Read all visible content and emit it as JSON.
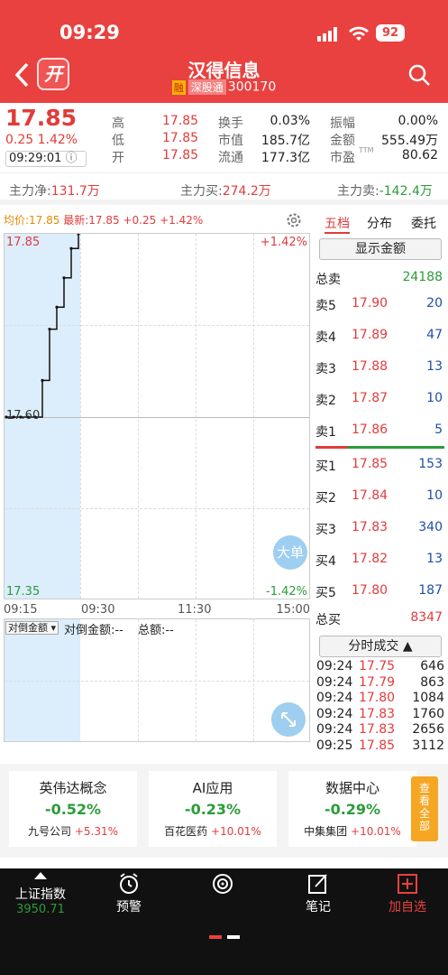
{
  "status": {
    "time": "09:29",
    "battery": "92"
  },
  "nav": {
    "logo": "开",
    "name": "汉得信息",
    "tag1": "融",
    "tag2": "深股通",
    "code": "300170"
  },
  "quote": {
    "price": "17.85",
    "change": "0.25",
    "change_pct": "1.42%",
    "time": "09:29:01",
    "cells": [
      {
        "label": "高",
        "value": "17.85",
        "color": "red"
      },
      {
        "label": "换手",
        "value": "0.03%",
        "color": "dark"
      },
      {
        "label": "振幅",
        "value": "0.00%",
        "color": "dark"
      },
      {
        "label": "低",
        "value": "17.85",
        "color": "red"
      },
      {
        "label": "市值",
        "value": "185.7亿",
        "color": "dark"
      },
      {
        "label": "金额",
        "value": "555.49万",
        "color": "dark"
      },
      {
        "label": "开",
        "value": "17.85",
        "color": "red"
      },
      {
        "label": "流通",
        "value": "177.3亿",
        "color": "dark"
      },
      {
        "label": "市盈",
        "value": "80.62",
        "color": "dark"
      }
    ],
    "ttm": "TTM"
  },
  "flow": {
    "net_label": "主力净:",
    "net": "131.7万",
    "buy_label": "主力买:",
    "buy": "274.2万",
    "sell_label": "主力卖:",
    "sell": "-142.4万"
  },
  "chart": {
    "avg_label": "均价:",
    "avg": "17.85",
    "latest_label": "最新:",
    "latest": "17.85",
    "latest_chg": "+0.25",
    "latest_pct": "+1.42%",
    "y_top": "17.85",
    "y_mid": "17.60",
    "y_bot": "17.35",
    "pct_top": "+1.42%",
    "pct_bot": "-1.42%",
    "x_ticks": [
      "09:15",
      "09:30",
      "11:30",
      "15:00"
    ],
    "sub_select": "对倒金额",
    "sub_l1": "对倒金额:--",
    "sub_l2": "总额:--",
    "big_order": "大单"
  },
  "chart_data": {
    "type": "line",
    "x": [
      "09:15",
      "09:16",
      "09:17",
      "09:18",
      "09:19",
      "09:20",
      "09:21",
      "09:22",
      "09:23",
      "09:24",
      "09:25"
    ],
    "values": [
      17.6,
      17.6,
      17.6,
      17.6,
      17.6,
      17.65,
      17.72,
      17.75,
      17.79,
      17.83,
      17.85
    ],
    "ylim": [
      17.35,
      17.85
    ]
  },
  "right": {
    "tabs": [
      "五档",
      "分布",
      "委托"
    ],
    "show_amount": "显示金额",
    "total_sell_label": "总卖",
    "total_sell": "24188",
    "asks": [
      {
        "l": "卖5",
        "p": "17.90",
        "v": "20"
      },
      {
        "l": "卖4",
        "p": "17.89",
        "v": "47"
      },
      {
        "l": "卖3",
        "p": "17.88",
        "v": "13"
      },
      {
        "l": "卖2",
        "p": "17.87",
        "v": "10"
      },
      {
        "l": "卖1",
        "p": "17.86",
        "v": "5"
      }
    ],
    "bids": [
      {
        "l": "买1",
        "p": "17.85",
        "v": "153"
      },
      {
        "l": "买2",
        "p": "17.84",
        "v": "10"
      },
      {
        "l": "买3",
        "p": "17.83",
        "v": "340"
      },
      {
        "l": "买4",
        "p": "17.82",
        "v": "13"
      },
      {
        "l": "买5",
        "p": "17.80",
        "v": "187"
      }
    ],
    "total_buy_label": "总买",
    "total_buy": "8347",
    "fenshi": "分时成交",
    "ticks": [
      {
        "t": "09:24",
        "p": "17.75",
        "v": "646"
      },
      {
        "t": "09:24",
        "p": "17.79",
        "v": "863"
      },
      {
        "t": "09:24",
        "p": "17.80",
        "v": "1084"
      },
      {
        "t": "09:24",
        "p": "17.83",
        "v": "1760"
      },
      {
        "t": "09:24",
        "p": "17.83",
        "v": "2656"
      },
      {
        "t": "09:25",
        "p": "17.85",
        "v": "3112"
      }
    ]
  },
  "concepts": [
    {
      "name": "英伟达概念",
      "chg": "-0.52%",
      "stock": "九号公司",
      "stock_chg": "+5.31%"
    },
    {
      "name": "AI应用",
      "chg": "-0.23%",
      "stock": "百花医药",
      "stock_chg": "+10.01%"
    },
    {
      "name": "数据中心",
      "chg": "-0.29%",
      "stock": "中集集团",
      "stock_chg": "+10.01%"
    }
  ],
  "see_all": "查看全部",
  "bottom": {
    "index_name": "上证指数",
    "index_value": "3950.71",
    "items": [
      "预警",
      "",
      "笔记",
      "加自选"
    ]
  },
  "colors": {
    "brand": "#e94140",
    "up": "#e23b3b",
    "down": "#2a9c3a"
  }
}
